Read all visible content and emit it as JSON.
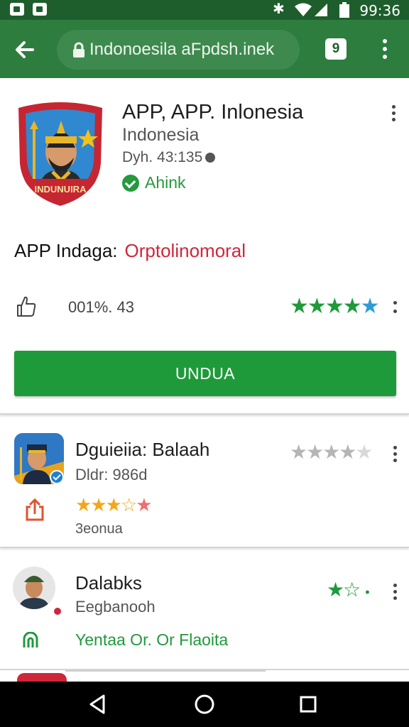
{
  "status_bar": {
    "time": "99:36",
    "icons": [
      "image-notification-icon",
      "app-notification-icon",
      "bluetooth-icon",
      "wifi-icon",
      "signal-icon",
      "battery-icon"
    ]
  },
  "toolbar": {
    "url": "Indonoesila aFpdsh.inek",
    "tab_count": "9"
  },
  "app": {
    "logo_text": "INDUNUIRA",
    "title": "APP, APP. Inlonesia",
    "subtitle": "Indonesia",
    "meta": "Dyh. 43:135",
    "verified_label": "Ahink",
    "tagline_label": "APP Indaga:",
    "tagline_value": "Orptolinomoral",
    "rating_count": "001%. 43",
    "rating_stars": 4.5,
    "install_label": "UNDUA"
  },
  "list": [
    {
      "title": "Dguieiia: Balaah",
      "subtitle": "Dldr: 986d",
      "rating_stars": 4,
      "user_rating": 3.5,
      "small_text": "3eonua"
    },
    {
      "title": "Dalabks",
      "subtitle": "Eegbanooh",
      "link_text": "Yentaa Or. Or Flaoita",
      "rating_stars": 1.5
    }
  ],
  "colors": {
    "status_bar": "#1e5e2c",
    "app_bar": "#2d7d3e",
    "accent_green": "#1f9a3a",
    "red": "#d0263a",
    "star_blue": "#2d9bd8",
    "star_yellow": "#f2a71b"
  }
}
